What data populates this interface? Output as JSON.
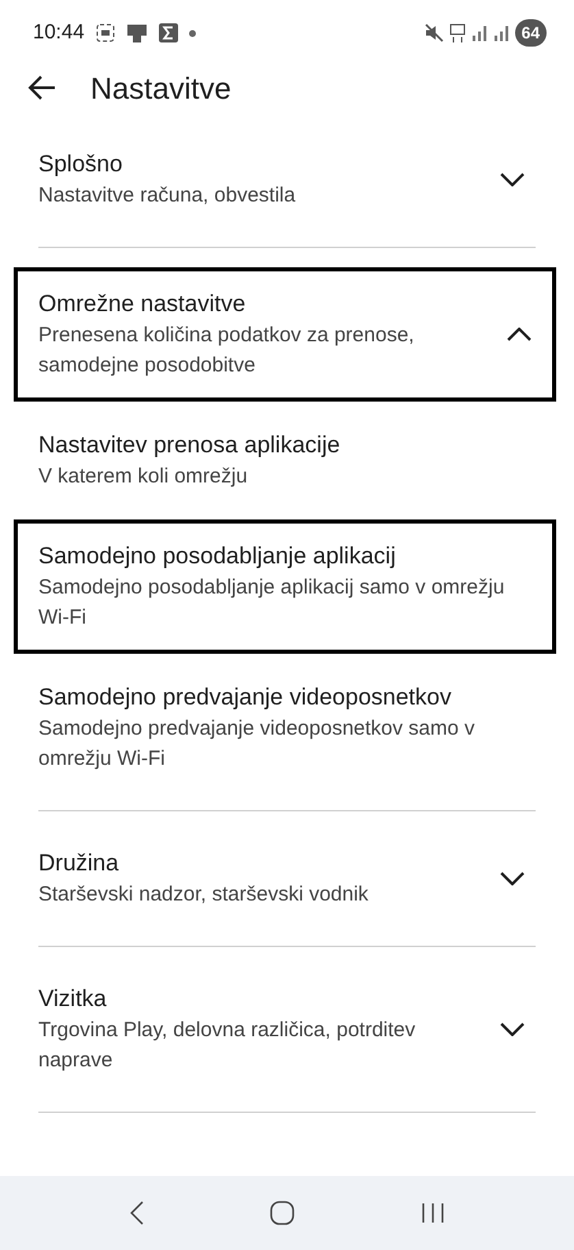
{
  "status_bar": {
    "time": "10:44",
    "battery": "64"
  },
  "header": {
    "title": "Nastavitve"
  },
  "sections": [
    {
      "title": "Splošno",
      "subtitle": "Nastavitve računa, obvestila",
      "expanded": false,
      "outlined": false
    },
    {
      "title": "Omrežne nastavitve",
      "subtitle": "Prenesena količina podatkov za prenose, samodejne posodobitve",
      "expanded": true,
      "outlined": true,
      "children": [
        {
          "title": "Nastavitev prenosa aplikacije",
          "subtitle": "V katerem koli omrežju",
          "outlined": false
        },
        {
          "title": "Samodejno posodabljanje aplikacij",
          "subtitle": "Samodejno posodabljanje aplikacij samo v omrežju Wi-Fi",
          "outlined": true
        },
        {
          "title": "Samodejno predvajanje videoposnetkov",
          "subtitle": "Samodejno predvajanje videoposnetkov samo v omrežju Wi-Fi",
          "outlined": false
        }
      ]
    },
    {
      "title": "Družina",
      "subtitle": "Starševski nadzor, starševski vodnik",
      "expanded": false,
      "outlined": false
    },
    {
      "title": "Vizitka",
      "subtitle": "Trgovina Play, delovna različica, potrditev naprave",
      "expanded": false,
      "outlined": false
    }
  ]
}
